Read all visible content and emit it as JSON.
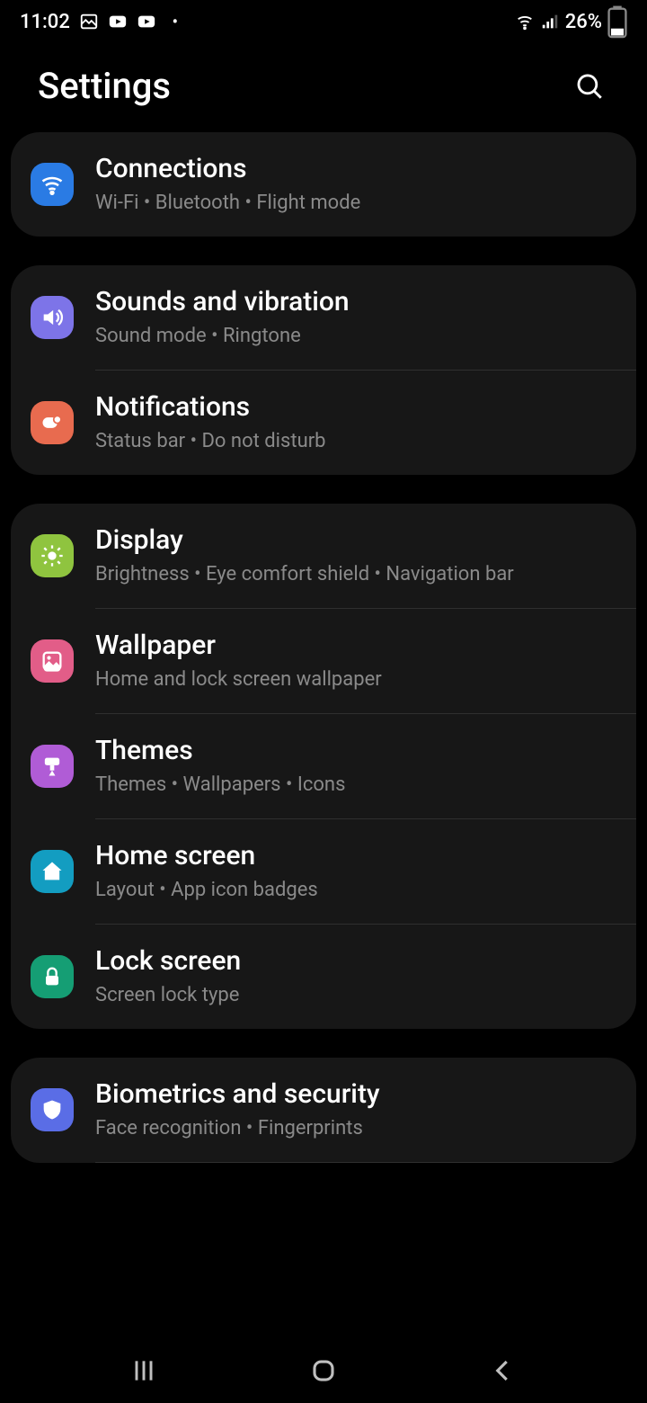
{
  "status": {
    "time": "11:02",
    "battery": "26%"
  },
  "header": {
    "title": "Settings"
  },
  "groups": [
    {
      "items": [
        {
          "key": "connections",
          "title": "Connections",
          "sub": "Wi-Fi  •  Bluetooth  •  Flight mode",
          "color": "bg-blue",
          "icon": "wifi"
        }
      ]
    },
    {
      "items": [
        {
          "key": "sounds",
          "title": "Sounds and vibration",
          "sub": "Sound mode  •  Ringtone",
          "color": "bg-purple",
          "icon": "sound"
        },
        {
          "key": "notifications",
          "title": "Notifications",
          "sub": "Status bar  •  Do not disturb",
          "color": "bg-orange",
          "icon": "notif"
        }
      ]
    },
    {
      "items": [
        {
          "key": "display",
          "title": "Display",
          "sub": "Brightness  •  Eye comfort shield  •  Navigation bar",
          "color": "bg-green",
          "icon": "bright"
        },
        {
          "key": "wallpaper",
          "title": "Wallpaper",
          "sub": "Home and lock screen wallpaper",
          "color": "bg-pink",
          "icon": "image"
        },
        {
          "key": "themes",
          "title": "Themes",
          "sub": "Themes  •  Wallpapers  •  Icons",
          "color": "bg-violet",
          "icon": "brush"
        },
        {
          "key": "home",
          "title": "Home screen",
          "sub": "Layout  •  App icon badges",
          "color": "bg-cyan",
          "icon": "home"
        },
        {
          "key": "lock",
          "title": "Lock screen",
          "sub": "Screen lock type",
          "color": "bg-teal",
          "icon": "lock"
        }
      ]
    },
    {
      "items": [
        {
          "key": "biometrics",
          "title": "Biometrics and security",
          "sub": "Face recognition  •  Fingerprints",
          "color": "bg-indigo",
          "icon": "shield"
        }
      ]
    }
  ]
}
